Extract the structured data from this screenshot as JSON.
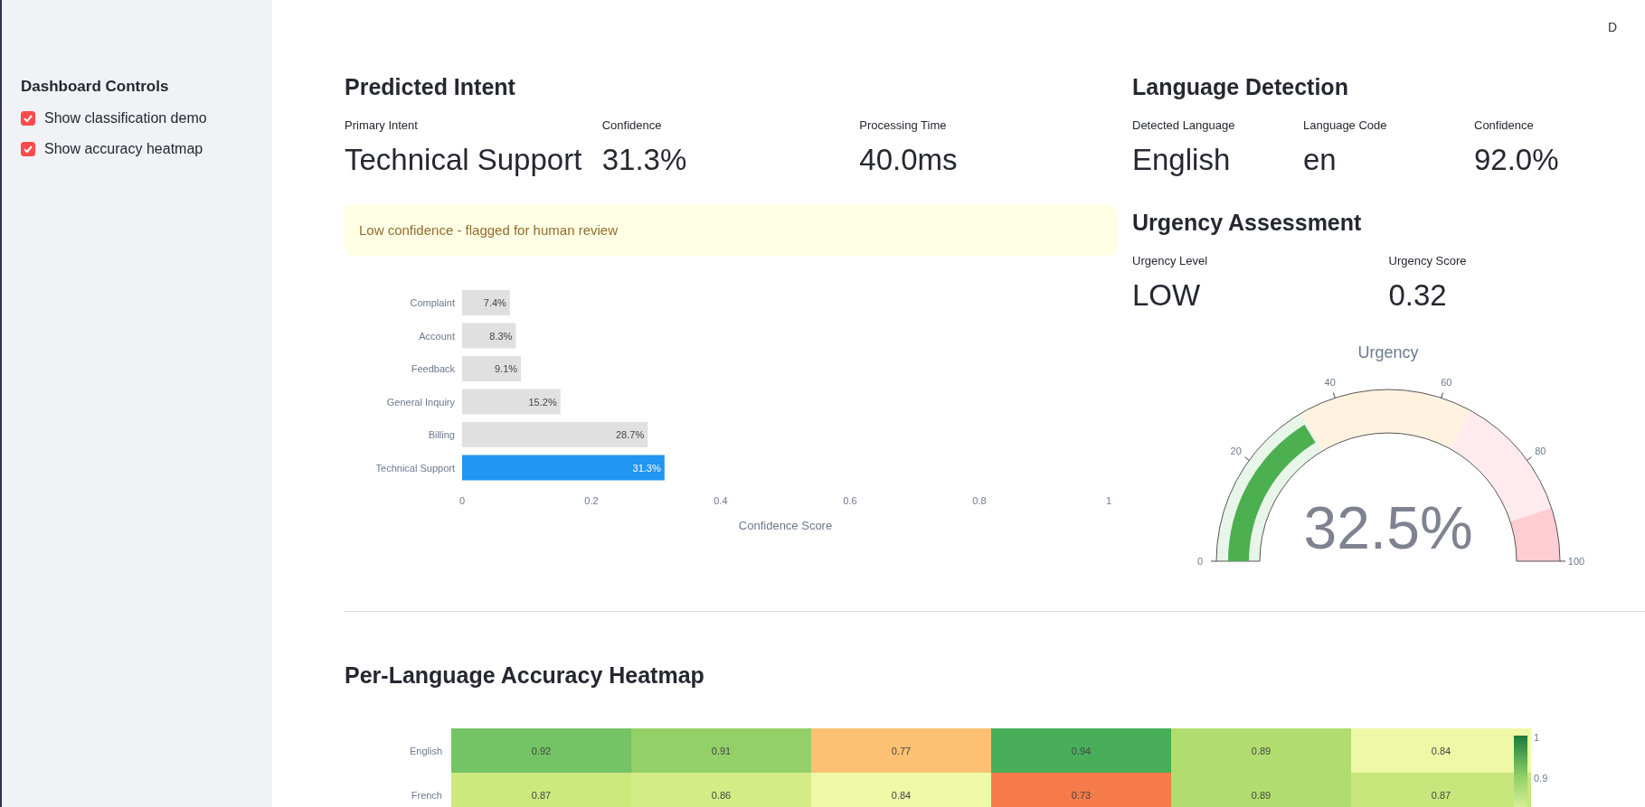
{
  "top_bar": {
    "deploy_fragment": "D"
  },
  "sidebar": {
    "title": "Dashboard Controls",
    "items": [
      {
        "label": "Show classification demo",
        "checked": true
      },
      {
        "label": "Show accuracy heatmap",
        "checked": true
      }
    ]
  },
  "intent": {
    "title": "Predicted Intent",
    "metrics": [
      {
        "label": "Primary Intent",
        "value": "Technical Support"
      },
      {
        "label": "Confidence",
        "value": "31.3%"
      },
      {
        "label": "Processing Time",
        "value": "40.0ms"
      }
    ],
    "alert": "Low confidence - flagged for human review",
    "chart_data": {
      "type": "bar",
      "orientation": "horizontal",
      "stacked": true,
      "xlabel": "Confidence Score",
      "categories": [
        "Complaint",
        "Account",
        "Feedback",
        "General Inquiry",
        "Billing",
        "Technical Support"
      ],
      "series": [
        {
          "color": "#e0e0e0",
          "values": [
            0.074,
            0.083,
            0.091,
            0.152,
            0.287,
            null
          ]
        },
        {
          "color": "#2196f3",
          "values": [
            null,
            null,
            null,
            null,
            null,
            0.313
          ]
        }
      ],
      "value_labels": [
        "7.4%",
        "8.3%",
        "9.1%",
        "15.2%",
        "28.7%",
        "31.3%"
      ],
      "xlim": [
        0,
        1
      ],
      "xticks": [
        0,
        0.2,
        0.4,
        0.6,
        0.8,
        1
      ]
    }
  },
  "language": {
    "title": "Language Detection",
    "metrics": [
      {
        "label": "Detected Language",
        "value": "English"
      },
      {
        "label": "Language Code",
        "value": "en"
      },
      {
        "label": "Confidence",
        "value": "92.0%"
      }
    ]
  },
  "urgency": {
    "title": "Urgency Assessment",
    "metrics": [
      {
        "label": "Urgency Level",
        "value": "LOW"
      },
      {
        "label": "Urgency Score",
        "value": "0.32"
      }
    ],
    "gauge": {
      "title": "Urgency",
      "level": 0.325,
      "reading": "32.5%",
      "ticks": [
        "0",
        "20",
        "40",
        "60",
        "80",
        "100"
      ]
    }
  },
  "heatmap": {
    "title": "Per-Language Accuracy Heatmap",
    "rows": [
      {
        "label": "English",
        "cells": [
          {
            "value": "0.92",
            "color": "#74c365"
          },
          {
            "value": "0.91",
            "color": "#93d068"
          },
          {
            "value": "0.77",
            "color": "#fdc173"
          },
          {
            "value": "0.94",
            "color": "#48ae5a"
          },
          {
            "value": "0.89",
            "color": "#b1dd70"
          },
          {
            "value": "0.84",
            "color": "#eef8a6"
          }
        ]
      },
      {
        "label": "French",
        "cells": [
          {
            "value": "0.87",
            "color": "#cce97e"
          },
          {
            "value": "0.86",
            "color": "#d4ec86"
          },
          {
            "value": "0.84",
            "color": "#eef8a6"
          },
          {
            "value": "0.73",
            "color": "#f67b4a"
          },
          {
            "value": "0.89",
            "color": "#b1dd70"
          },
          {
            "value": "0.87",
            "color": "#c7e67c"
          }
        ]
      }
    ],
    "colorbar_ticks": [
      "1",
      "0.9"
    ]
  }
}
